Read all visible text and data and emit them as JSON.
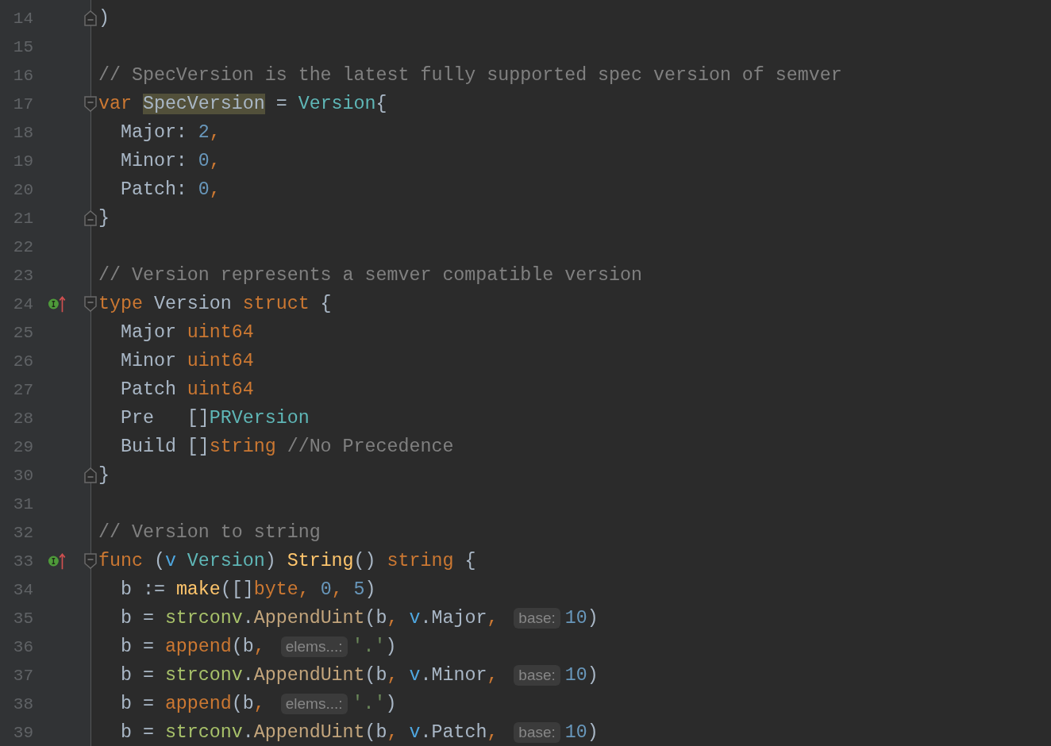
{
  "lines": [
    {
      "number": "14",
      "fold_start": false,
      "fold_end": true,
      "implemented": false,
      "tokens": [
        {
          "kind": "plain",
          "text": ")"
        }
      ]
    },
    {
      "number": "15",
      "fold_start": false,
      "fold_end": false,
      "implemented": false
    },
    {
      "number": "16",
      "fold_start": false,
      "fold_end": false,
      "implemented": false,
      "tokens": [
        {
          "kind": "comment",
          "text": "// SpecVersion is the latest fully supported spec version of semver"
        }
      ]
    },
    {
      "number": "17",
      "fold_start": true,
      "fold_end": false,
      "implemented": false,
      "tokens": [
        {
          "kind": "keyword",
          "text": "var "
        },
        {
          "kind": "highlight",
          "text": "SpecVersion"
        },
        {
          "kind": "plain",
          "text": " = "
        },
        {
          "kind": "type",
          "text": "Version"
        },
        {
          "kind": "plain",
          "text": "{"
        }
      ]
    },
    {
      "number": "18",
      "fold_start": false,
      "fold_end": false,
      "implemented": false,
      "tokens": [
        {
          "kind": "plain",
          "text": "  Major: "
        },
        {
          "kind": "number",
          "text": "2"
        },
        {
          "kind": "punct",
          "text": ","
        }
      ]
    },
    {
      "number": "19",
      "fold_start": false,
      "fold_end": false,
      "implemented": false,
      "tokens": [
        {
          "kind": "plain",
          "text": "  Minor: "
        },
        {
          "kind": "number",
          "text": "0"
        },
        {
          "kind": "punct",
          "text": ","
        }
      ]
    },
    {
      "number": "20",
      "fold_start": false,
      "fold_end": false,
      "implemented": false,
      "tokens": [
        {
          "kind": "plain",
          "text": "  Patch: "
        },
        {
          "kind": "number",
          "text": "0"
        },
        {
          "kind": "punct",
          "text": ","
        }
      ]
    },
    {
      "number": "21",
      "fold_start": false,
      "fold_end": true,
      "implemented": false,
      "tokens": [
        {
          "kind": "plain",
          "text": "}"
        }
      ]
    },
    {
      "number": "22",
      "fold_start": false,
      "fold_end": false,
      "implemented": false
    },
    {
      "number": "23",
      "fold_start": false,
      "fold_end": false,
      "implemented": false,
      "tokens": [
        {
          "kind": "comment",
          "text": "// Version represents a semver compatible version"
        }
      ]
    },
    {
      "number": "24",
      "fold_start": true,
      "fold_end": false,
      "implemented": true,
      "tokens": [
        {
          "kind": "keyword",
          "text": "type "
        },
        {
          "kind": "plain",
          "text": "Version "
        },
        {
          "kind": "keyword",
          "text": "struct"
        },
        {
          "kind": "plain",
          "text": " {"
        }
      ]
    },
    {
      "number": "25",
      "fold_start": false,
      "fold_end": false,
      "implemented": false,
      "tokens": [
        {
          "kind": "plain",
          "text": "  Major "
        },
        {
          "kind": "keyword",
          "text": "uint64"
        }
      ]
    },
    {
      "number": "26",
      "fold_start": false,
      "fold_end": false,
      "implemented": false,
      "tokens": [
        {
          "kind": "plain",
          "text": "  Minor "
        },
        {
          "kind": "keyword",
          "text": "uint64"
        }
      ]
    },
    {
      "number": "27",
      "fold_start": false,
      "fold_end": false,
      "implemented": false,
      "tokens": [
        {
          "kind": "plain",
          "text": "  Patch "
        },
        {
          "kind": "keyword",
          "text": "uint64"
        }
      ]
    },
    {
      "number": "28",
      "fold_start": false,
      "fold_end": false,
      "implemented": false,
      "tokens": [
        {
          "kind": "plain",
          "text": "  Pre   []"
        },
        {
          "kind": "type",
          "text": "PRVersion"
        }
      ]
    },
    {
      "number": "29",
      "fold_start": false,
      "fold_end": false,
      "implemented": false,
      "tokens": [
        {
          "kind": "plain",
          "text": "  Build []"
        },
        {
          "kind": "keyword",
          "text": "string"
        },
        {
          "kind": "comment",
          "text": " //No Precedence"
        }
      ]
    },
    {
      "number": "30",
      "fold_start": false,
      "fold_end": true,
      "implemented": false,
      "tokens": [
        {
          "kind": "plain",
          "text": "}"
        }
      ]
    },
    {
      "number": "31",
      "fold_start": false,
      "fold_end": false,
      "implemented": false
    },
    {
      "number": "32",
      "fold_start": false,
      "fold_end": false,
      "implemented": false,
      "tokens": [
        {
          "kind": "comment",
          "text": "// Version to string"
        }
      ]
    },
    {
      "number": "33",
      "fold_start": true,
      "fold_end": false,
      "implemented": true,
      "tokens": [
        {
          "kind": "keyword",
          "text": "func "
        },
        {
          "kind": "plain",
          "text": "("
        },
        {
          "kind": "param",
          "text": "v"
        },
        {
          "kind": "type",
          "text": " Version"
        },
        {
          "kind": "plain",
          "text": ") "
        },
        {
          "kind": "func",
          "text": "String"
        },
        {
          "kind": "plain",
          "text": "() "
        },
        {
          "kind": "keyword",
          "text": "string"
        },
        {
          "kind": "plain",
          "text": " {"
        }
      ]
    },
    {
      "number": "34",
      "fold_start": false,
      "fold_end": false,
      "implemented": false,
      "tokens": [
        {
          "kind": "plain",
          "text": "  b := "
        },
        {
          "kind": "func",
          "text": "make"
        },
        {
          "kind": "plain",
          "text": "([]"
        },
        {
          "kind": "keyword",
          "text": "byte"
        },
        {
          "kind": "punct",
          "text": ", "
        },
        {
          "kind": "number",
          "text": "0"
        },
        {
          "kind": "punct",
          "text": ", "
        },
        {
          "kind": "number",
          "text": "5"
        },
        {
          "kind": "plain",
          "text": ")"
        }
      ]
    },
    {
      "number": "35",
      "fold_start": false,
      "fold_end": false,
      "implemented": false,
      "tokens": [
        {
          "kind": "plain",
          "text": "  b = "
        },
        {
          "kind": "package",
          "text": "strconv"
        },
        {
          "kind": "plain",
          "text": "."
        },
        {
          "kind": "method",
          "text": "AppendUint"
        },
        {
          "kind": "plain",
          "text": "(b"
        },
        {
          "kind": "punct",
          "text": ", "
        },
        {
          "kind": "param",
          "text": "v"
        },
        {
          "kind": "plain",
          "text": ".Major"
        },
        {
          "kind": "punct",
          "text": ","
        },
        {
          "kind": "hint",
          "text": "base:"
        },
        {
          "kind": "number",
          "text": "10"
        },
        {
          "kind": "plain",
          "text": ")"
        }
      ]
    },
    {
      "number": "36",
      "fold_start": false,
      "fold_end": false,
      "implemented": false,
      "tokens": [
        {
          "kind": "plain",
          "text": "  b = "
        },
        {
          "kind": "builtin",
          "text": "append"
        },
        {
          "kind": "plain",
          "text": "(b"
        },
        {
          "kind": "punct",
          "text": ","
        },
        {
          "kind": "hint",
          "text": "elems...:"
        },
        {
          "kind": "string",
          "text": "'.'"
        },
        {
          "kind": "plain",
          "text": ")"
        }
      ]
    },
    {
      "number": "37",
      "fold_start": false,
      "fold_end": false,
      "implemented": false,
      "tokens": [
        {
          "kind": "plain",
          "text": "  b = "
        },
        {
          "kind": "package",
          "text": "strconv"
        },
        {
          "kind": "plain",
          "text": "."
        },
        {
          "kind": "method",
          "text": "AppendUint"
        },
        {
          "kind": "plain",
          "text": "(b"
        },
        {
          "kind": "punct",
          "text": ", "
        },
        {
          "kind": "param",
          "text": "v"
        },
        {
          "kind": "plain",
          "text": ".Minor"
        },
        {
          "kind": "punct",
          "text": ","
        },
        {
          "kind": "hint",
          "text": "base:"
        },
        {
          "kind": "number",
          "text": "10"
        },
        {
          "kind": "plain",
          "text": ")"
        }
      ]
    },
    {
      "number": "38",
      "fold_start": false,
      "fold_end": false,
      "implemented": false,
      "tokens": [
        {
          "kind": "plain",
          "text": "  b = "
        },
        {
          "kind": "builtin",
          "text": "append"
        },
        {
          "kind": "plain",
          "text": "(b"
        },
        {
          "kind": "punct",
          "text": ","
        },
        {
          "kind": "hint",
          "text": "elems...:"
        },
        {
          "kind": "string",
          "text": "'.'"
        },
        {
          "kind": "plain",
          "text": ")"
        }
      ]
    },
    {
      "number": "39",
      "fold_start": false,
      "fold_end": false,
      "implemented": false,
      "tokens": [
        {
          "kind": "plain",
          "text": "  b = "
        },
        {
          "kind": "package",
          "text": "strconv"
        },
        {
          "kind": "plain",
          "text": "."
        },
        {
          "kind": "method",
          "text": "AppendUint"
        },
        {
          "kind": "plain",
          "text": "(b"
        },
        {
          "kind": "punct",
          "text": ", "
        },
        {
          "kind": "param",
          "text": "v"
        },
        {
          "kind": "plain",
          "text": ".Patch"
        },
        {
          "kind": "punct",
          "text": ","
        },
        {
          "kind": "hint",
          "text": "base:"
        },
        {
          "kind": "number",
          "text": "10"
        },
        {
          "kind": "plain",
          "text": ")"
        }
      ]
    }
  ]
}
